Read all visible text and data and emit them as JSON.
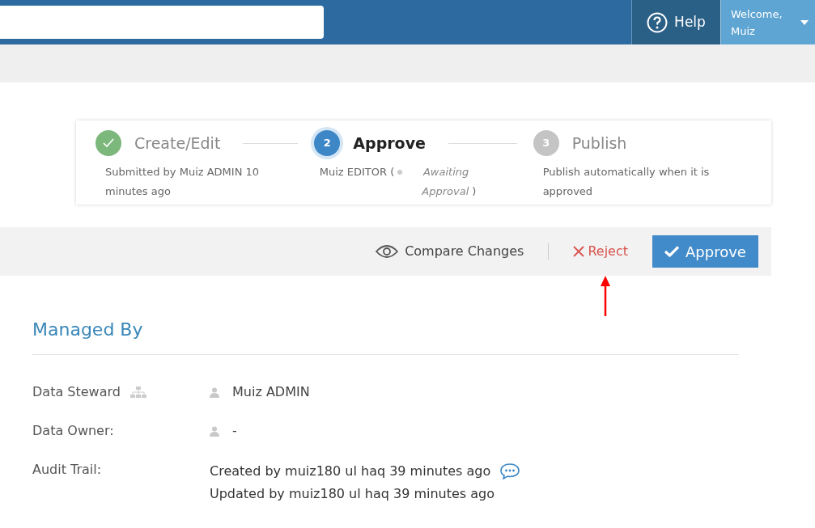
{
  "header": {
    "help": "Help",
    "welcome": "Welcome,",
    "user": "Muiz"
  },
  "steps": [
    {
      "kind": "done",
      "title": "Create/Edit",
      "detail": "Submitted by Muiz ADMIN 10 minutes ago"
    },
    {
      "kind": "active",
      "number": "2",
      "title": "Approve",
      "detail": "Muiz EDITOR (",
      "status": "Awaiting Approval",
      "detail_end": ")"
    },
    {
      "kind": "pending",
      "number": "3",
      "title": "Publish",
      "detail": "Publish automatically when it is approved"
    }
  ],
  "actions": {
    "compare": "Compare Changes",
    "reject": "Reject",
    "approve": "Approve"
  },
  "section": {
    "title": "Managed By",
    "rows": [
      {
        "kind": "person",
        "label": "Data Steward",
        "hierarchy": true,
        "value": "Muiz ADMIN"
      },
      {
        "kind": "person",
        "label": "Data Owner:",
        "hierarchy": false,
        "value": "-"
      },
      {
        "kind": "audit",
        "label": "Audit Trail:",
        "lines": [
          "Created by muiz180 ul haq 39 minutes ago",
          "Updated by muiz180 ul haq 39 minutes ago"
        ]
      }
    ]
  }
}
